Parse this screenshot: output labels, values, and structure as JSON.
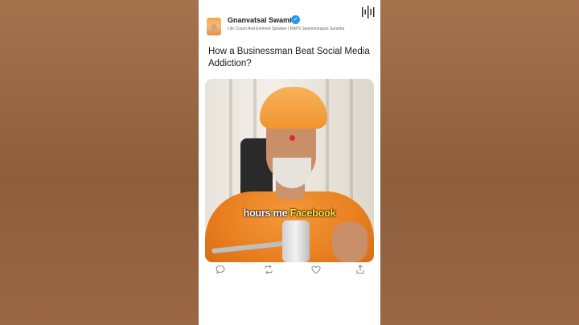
{
  "post": {
    "author": "Gnanvatsal Swami",
    "verified": true,
    "subtitle": "Life Coach And Eminent Speaker | BAPS Swaminarayan Sanstha",
    "title": "How a Businessman Beat Social Media Addiction?"
  },
  "video": {
    "caption_prefix": "hours me ",
    "caption_highlight": "Facebook"
  },
  "actions": [
    {
      "name": "comment",
      "icon": "comment-icon"
    },
    {
      "name": "repost",
      "icon": "repost-icon"
    },
    {
      "name": "like",
      "icon": "heart-icon"
    },
    {
      "name": "share",
      "icon": "share-icon"
    }
  ],
  "colors": {
    "accent": "#1d9bf0",
    "caption_highlight": "#ffe43a",
    "background": "#9b6a47"
  }
}
